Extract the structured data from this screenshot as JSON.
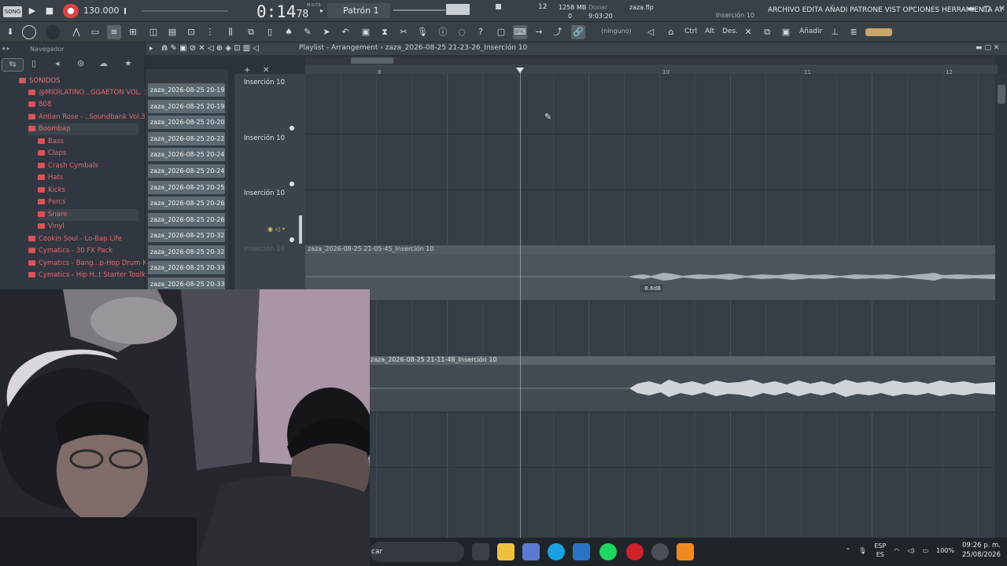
{
  "topbar": {
    "mode": "SONG",
    "tempo": "130.000",
    "time_main": "0:14",
    "time_sub": "78",
    "time_unit": "M:S:CS",
    "pattern": "Patrón 1",
    "cpu": "12",
    "mem": "1258 MB",
    "mem2": "0",
    "hint1": "Donar",
    "hint2": "9:03:20",
    "file": "zaza.flp",
    "insert": "Inserción 10",
    "menu": "ARCHIVO EDITA AÑADI PATRONE VIST OPCIONES HERRAMIENTA AY"
  },
  "toolbar": {
    "none_label": "(ninguno)",
    "ctrl": "Ctrl",
    "alt": "Alt",
    "des": "Des.",
    "add": "Añadir"
  },
  "browser": {
    "title": "Navegador",
    "items": [
      {
        "label": "SONIDOS"
      },
      {
        "label": "@MIDILATINO...GGAETON VOL. 1"
      },
      {
        "label": "808"
      },
      {
        "label": "Antian Rose - ..Soundbank Vol.3"
      },
      {
        "label": "Boombap"
      },
      {
        "label": "Bass"
      },
      {
        "label": "Claps"
      },
      {
        "label": "Crash Cymbals"
      },
      {
        "label": "Hats"
      },
      {
        "label": "Kicks"
      },
      {
        "label": "Percs"
      },
      {
        "label": "Snare"
      },
      {
        "label": "Vinyl"
      },
      {
        "label": "Cookin Soul - Lo-Bap Life"
      },
      {
        "label": "Cymatics - 30 FX Pack"
      },
      {
        "label": "Cymatics - Bang...p-Hop Drum Kit"
      },
      {
        "label": "Cymatics - Hip H..t Starter Toolkit"
      }
    ]
  },
  "picker": {
    "items": [
      "zaza_2026-08-25 20-19...",
      "zaza_2026-08-25 20-19...",
      "zaza_2026-08-25 20-20...",
      "zaza_2026-08-25 20-22...",
      "zaza_2026-08-25 20-24...",
      "zaza_2026-08-25 20-24...",
      "zaza_2026-08-25 20-25...",
      "zaza_2026-08-25 20-26...",
      "zaza_2026-08-25 20-26...",
      "zaza_2026-08-25 20-32...",
      "zaza_2026-08-25 20-32...",
      "zaza_2026-08-25 20-33...",
      "zaza_2026-08-25 20-33..."
    ]
  },
  "playlist": {
    "title": "Playlist - Arrangement › zaza_2026-08-25 21-23-26_Inserción 10",
    "ruler": [
      "8",
      "10",
      "11",
      "12"
    ],
    "tracks": [
      "Inserción 10",
      "Inserción 10",
      "Inserción 10",
      "Inserción 10"
    ],
    "clip1": "zaza_2026-08-25 21-05-45_Inserción 10",
    "clip2": "zaza_2026-08-25 21-11-48_Inserción 10",
    "db": "-8.6dB"
  },
  "taskbar": {
    "search": "car",
    "lang1": "ESP",
    "lang2": "ES",
    "battery": "100%",
    "time": "09:26 p. m.",
    "date": "25/08/2026"
  },
  "colors": {
    "record": "#d9444a",
    "browser_text": "#e46a6f",
    "clip": "#5d6a73"
  }
}
